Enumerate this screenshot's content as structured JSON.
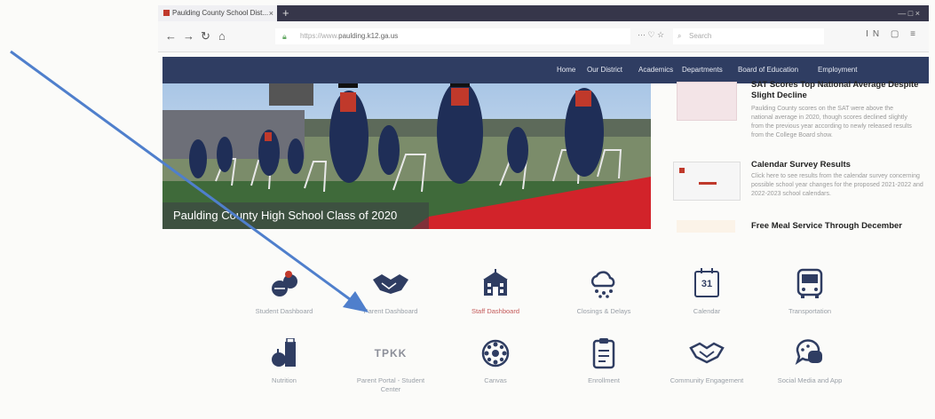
{
  "browser": {
    "tab_title": "Paulding County School Dist...",
    "tab_close": "×",
    "new_tab": "+",
    "url_prefix": "https://www.",
    "url_domain": "paulding.k12.ga.us",
    "toolbar_extra": "··· ♡ ☆",
    "search_placeholder": "Search",
    "window_controls": "— □ ×",
    "right_tools": "IN ▢ ≡"
  },
  "nav": {
    "items": [
      "Home",
      "Our District",
      "Academics",
      "Departments",
      "Board of Education",
      "Employment"
    ]
  },
  "hero": {
    "caption": "Paulding County High School Class of 2020"
  },
  "news": {
    "items": [
      {
        "title": "SAT Scores Top National Average Despite Slight Decline",
        "text": "Paulding County scores on the SAT were above the national average in 2020, though scores declined slightly from the previous year according to newly released results from the College Board show."
      },
      {
        "title": "Calendar Survey Results",
        "text": "Click here to see results from the calendar survey concerning possible school year changes for the proposed 2021-2022 and 2022-2023 school calendars."
      },
      {
        "title": "Free Meal Service Through December",
        "text": ""
      }
    ]
  },
  "quick_links": [
    {
      "label": "Student Dashboard",
      "icon": "student-icon"
    },
    {
      "label": "Parent Dashboard",
      "icon": "handshake-icon"
    },
    {
      "label": "Staff Dashboard",
      "icon": "school-icon"
    },
    {
      "label": "Closings & Delays",
      "icon": "weather-cloud-icon"
    },
    {
      "label": "Calendar",
      "icon": "calendar-icon",
      "number": "31"
    },
    {
      "label": "Transportation",
      "icon": "bus-icon"
    },
    {
      "label": "Nutrition",
      "icon": "nutrition-icon"
    },
    {
      "label": "Parent Portal - Student Center",
      "icon": "portal-icon",
      "icon_text": "TPKK"
    },
    {
      "label": "Canvas",
      "icon": "canvas-icon"
    },
    {
      "label": "Enrollment",
      "icon": "clipboard-icon"
    },
    {
      "label": "Community Engagement",
      "icon": "community-handshake-icon"
    },
    {
      "label": "Social Media and App",
      "icon": "chat-icon"
    }
  ],
  "colors": {
    "nav_bg": "#2f3d62",
    "icon_navy": "#2f3d62",
    "accent_red": "#c0392b",
    "arrow_blue": "#4f7fcc"
  }
}
